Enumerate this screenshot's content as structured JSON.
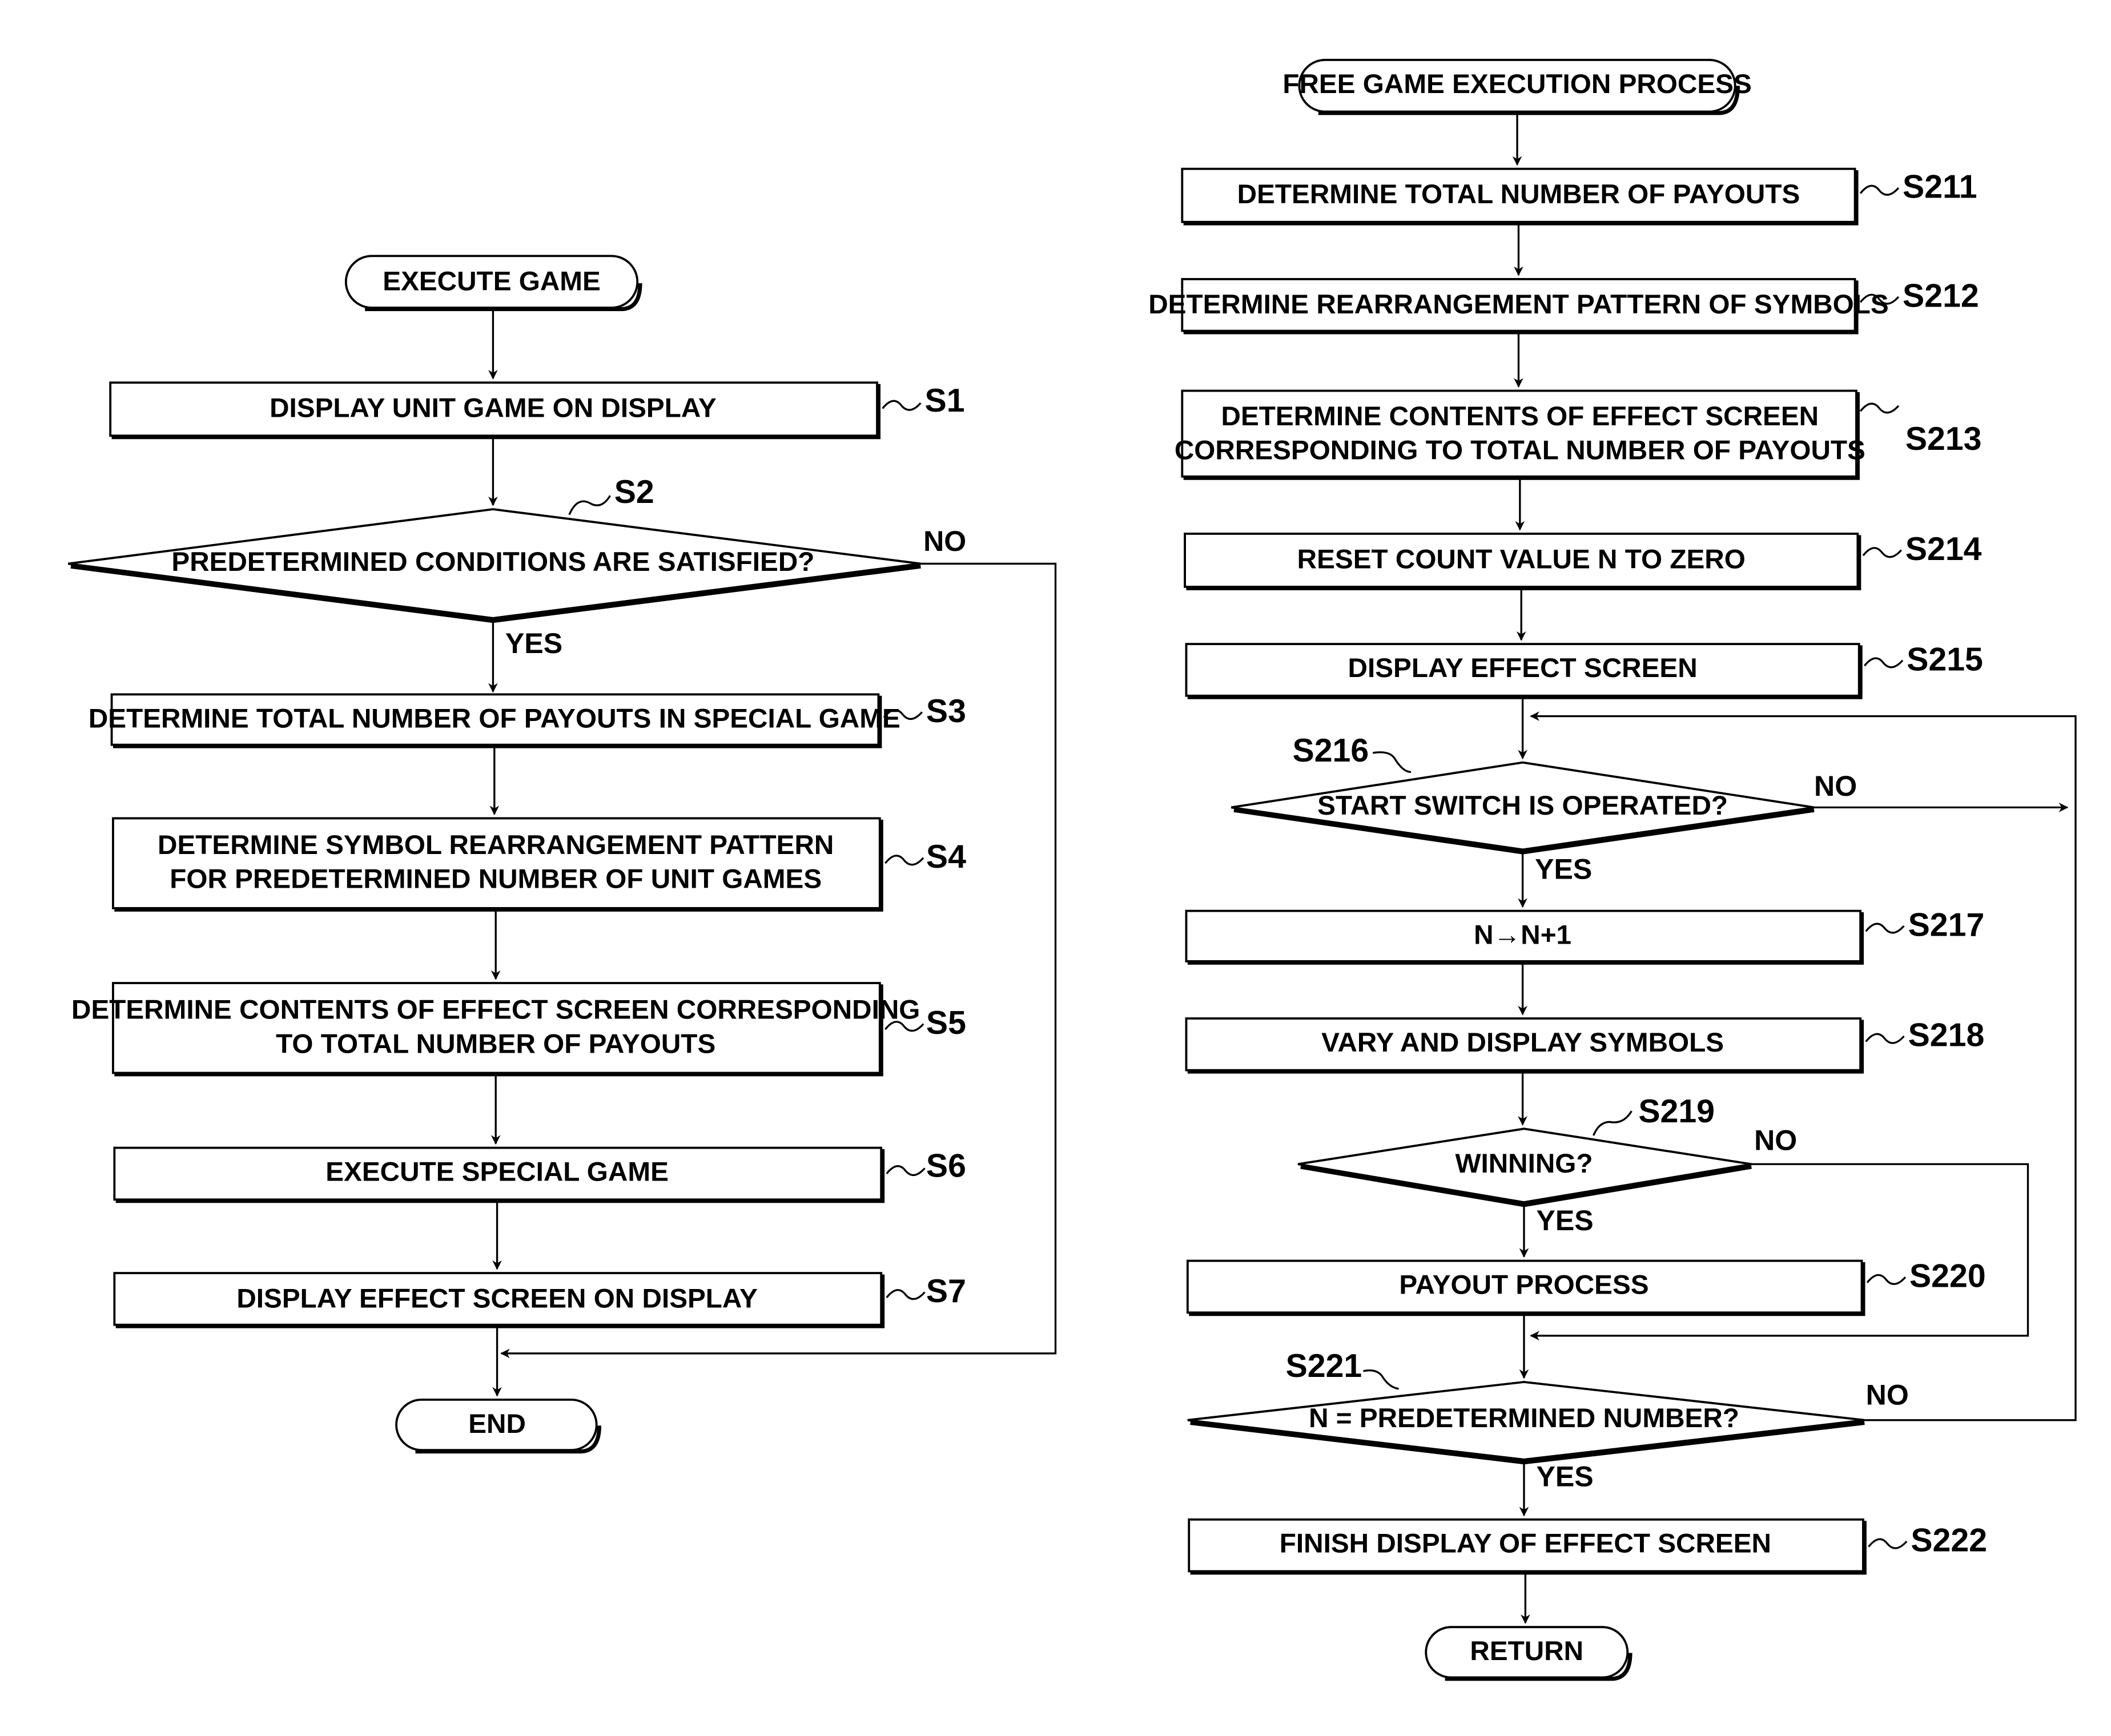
{
  "left_flow": {
    "start": "EXECUTE GAME",
    "steps": {
      "S1": {
        "id": "S1",
        "text": [
          "DISPLAY UNIT GAME ON DISPLAY"
        ]
      },
      "S2": {
        "id": "S2",
        "text": [
          "PREDETERMINED CONDITIONS ARE SATISFIED?"
        ],
        "yes": "YES",
        "no": "NO"
      },
      "S3": {
        "id": "S3",
        "text": [
          "DETERMINE TOTAL NUMBER OF PAYOUTS IN SPECIAL GAME"
        ]
      },
      "S4": {
        "id": "S4",
        "text": [
          "DETERMINE SYMBOL REARRANGEMENT PATTERN",
          "FOR PREDETERMINED NUMBER OF UNIT GAMES"
        ]
      },
      "S5": {
        "id": "S5",
        "text": [
          "DETERMINE CONTENTS OF EFFECT SCREEN CORRESPONDING",
          "TO TOTAL NUMBER OF PAYOUTS"
        ]
      },
      "S6": {
        "id": "S6",
        "text": [
          "EXECUTE SPECIAL GAME"
        ]
      },
      "S7": {
        "id": "S7",
        "text": [
          "DISPLAY EFFECT SCREEN ON DISPLAY"
        ]
      }
    },
    "end": "END"
  },
  "right_flow": {
    "start": "FREE GAME EXECUTION PROCESS",
    "steps": {
      "S211": {
        "id": "S211",
        "text": [
          "DETERMINE TOTAL NUMBER OF PAYOUTS"
        ]
      },
      "S212": {
        "id": "S212",
        "text": [
          "DETERMINE REARRANGEMENT PATTERN OF SYMBOLS"
        ]
      },
      "S213": {
        "id": "S213",
        "text": [
          "DETERMINE CONTENTS OF EFFECT SCREEN",
          "CORRESPONDING TO TOTAL NUMBER OF PAYOUTS"
        ]
      },
      "S214": {
        "id": "S214",
        "text": [
          "RESET COUNT VALUE N TO ZERO"
        ]
      },
      "S215": {
        "id": "S215",
        "text": [
          "DISPLAY EFFECT SCREEN"
        ]
      },
      "S216": {
        "id": "S216",
        "text": [
          "START SWITCH IS OPERATED?"
        ],
        "yes": "YES",
        "no": "NO"
      },
      "S217": {
        "id": "S217",
        "text": [
          "N→N+1"
        ]
      },
      "S218": {
        "id": "S218",
        "text": [
          "VARY AND DISPLAY SYMBOLS"
        ]
      },
      "S219": {
        "id": "S219",
        "text": [
          "WINNING?"
        ],
        "yes": "YES",
        "no": "NO"
      },
      "S220": {
        "id": "S220",
        "text": [
          "PAYOUT PROCESS"
        ]
      },
      "S221": {
        "id": "S221",
        "text": [
          "N = PREDETERMINED NUMBER?"
        ],
        "yes": "YES",
        "no": "NO"
      },
      "S222": {
        "id": "S222",
        "text": [
          "FINISH DISPLAY OF EFFECT SCREEN"
        ]
      }
    },
    "end": "RETURN"
  }
}
